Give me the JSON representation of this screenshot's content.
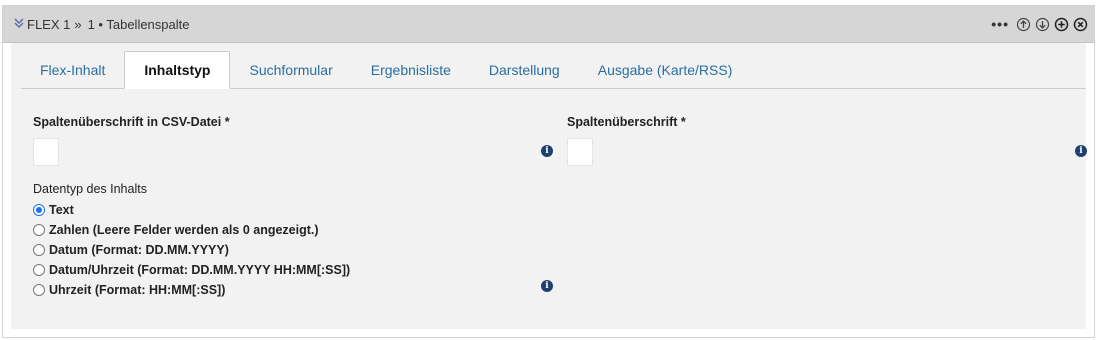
{
  "header": {
    "collapse_icon": "double-chevron-down-icon",
    "flex_label": "FLEX 1",
    "separator": "»",
    "title": "1 • Tabellenspalte",
    "more_label": "•••",
    "controls": [
      "move-up-icon",
      "move-down-icon",
      "add-icon",
      "close-icon"
    ]
  },
  "tabs": [
    {
      "label": "Flex-Inhalt",
      "active": false
    },
    {
      "label": "Inhaltstyp",
      "active": true
    },
    {
      "label": "Suchformular",
      "active": false
    },
    {
      "label": "Ergebnisliste",
      "active": false
    },
    {
      "label": "Darstellung",
      "active": false
    },
    {
      "label": "Ausgabe (Karte/RSS)",
      "active": false
    }
  ],
  "form": {
    "csv_heading_label": "Spaltenüberschrift in CSV-Datei *",
    "csv_heading_value": "",
    "heading_label": "Spaltenüberschrift *",
    "heading_value": "",
    "datatype_label": "Datentyp des Inhalts",
    "datatype_options": [
      {
        "label": "Text",
        "checked": true
      },
      {
        "label": "Zahlen (Leere Felder werden als 0 angezeigt.)",
        "checked": false
      },
      {
        "label": "Datum (Format: DD.MM.YYYY)",
        "checked": false
      },
      {
        "label": "Datum/Uhrzeit (Format: DD.MM.YYYY HH:MM[:SS])",
        "checked": false
      },
      {
        "label": "Uhrzeit (Format: HH:MM[:SS])",
        "checked": false
      }
    ],
    "info_glyph": "i"
  },
  "colors": {
    "header_bg": "#d6d6d6",
    "tab_link": "#2a6ea0",
    "info_icon": "#1f3f73",
    "radio_checked": "#1a73e8"
  }
}
